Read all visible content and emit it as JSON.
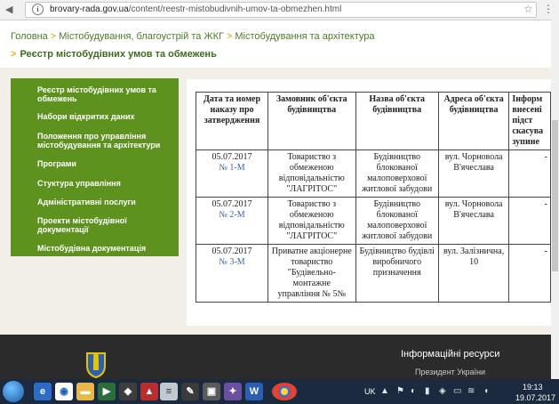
{
  "browser": {
    "url_domain": "brovary-rada.gov.ua",
    "url_path": "/content/reestr-mistobudivnih-umov-ta-obmezhen.html"
  },
  "breadcrumb": [
    "Головна",
    "Містобудування, благоустрій та ЖКГ",
    "Містобудування та архітектура"
  ],
  "section_title": "Реєстр містобудівних умов та обмежень",
  "sidebar": {
    "items": [
      "Реєстр містобудівних умов та обмежень",
      "Набори відкритих даних",
      "Положення про управління містобудування та архітектури",
      "Програми",
      "Стуктура управління",
      "Адміністративні послуги",
      "Проекти містобудівної документації",
      "Містобудівна документація"
    ]
  },
  "table": {
    "headers": [
      "Дата та номер наказу про затвердження",
      "Замовник об'єкта будівництва",
      "Назва об'єкта будівництва",
      "Адреса об'єкта будівництва",
      "Інформ внесені підст скасува зупине"
    ],
    "rows": [
      {
        "date": "05.07.2017",
        "num": "№ 1-М",
        "customer": "Товариство з обмеженою відповідальністю \"ЛАГРІТОС\"",
        "object": "Будівництво блокованої малоповерхової житлової забудови",
        "address": "вул. Чорновола В'ячеслава",
        "info": "-"
      },
      {
        "date": "05.07.2017",
        "num": "№ 2-М",
        "customer": "Товариство з обмеженою відповідальністю \"ЛАГРІТОС\"",
        "object": "Будівництво блокованої малоповерхової житлової забудови",
        "address": "вул. Чорновола В'ячеслава",
        "info": "-"
      },
      {
        "date": "05.07.2017",
        "num": "№ 3-М",
        "customer": "Приватне акціонерне товариство \"Будівельно-монтажне управління № 5№",
        "object": "Будівництво будівлі виробничого призначення",
        "address": "вул. Залізнична, 10",
        "info": "-"
      }
    ]
  },
  "footer": {
    "info_title": "Інформаційні ресурси",
    "link1": "Президент України"
  },
  "taskbar": {
    "lang": "UK",
    "time": "19:13",
    "date": "19.07.2017"
  }
}
